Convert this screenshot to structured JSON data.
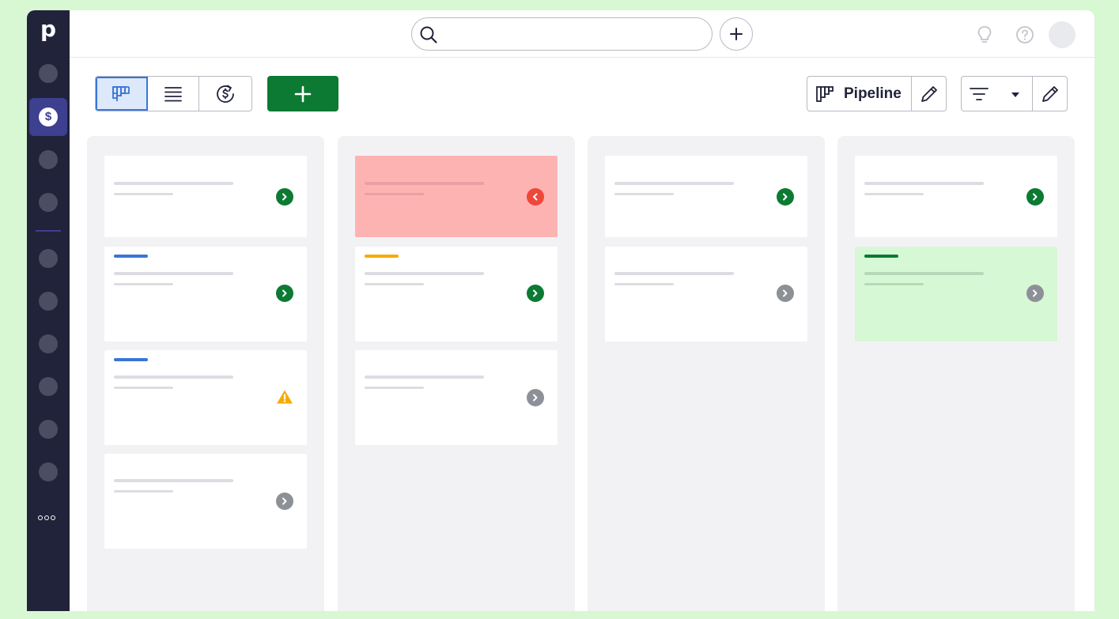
{
  "app": {
    "logo_letter": "p"
  },
  "sidebar": {
    "items": [
      "nav-item-1",
      "deals",
      "nav-item-3",
      "nav-item-4",
      "nav-item-5",
      "nav-item-6",
      "nav-item-7",
      "nav-item-8",
      "nav-item-9",
      "nav-item-10"
    ],
    "active_icon_text": "$"
  },
  "topbar": {
    "search_placeholder": ""
  },
  "toolbar": {
    "views": [
      "pipeline-view-icon",
      "list-view-icon",
      "forecast-view-icon"
    ],
    "active_view": "pipeline-view-icon",
    "new_button_icon": "plus-icon",
    "pipeline_label": "Pipeline"
  },
  "colors": {
    "accent_green": "#0c7a33",
    "accent_blue": "#3a75d8",
    "warning_orange": "#f7ab00",
    "danger_red": "#ef473a",
    "sidebar": "#21233a"
  },
  "board": {
    "columns": [
      {
        "cards": [
          {
            "status": "go",
            "tag": null,
            "bg": "white"
          },
          {
            "status": "go",
            "tag": "#3a75d8",
            "bg": "white"
          },
          {
            "status": "warning",
            "tag": "#3a75d8",
            "bg": "white"
          },
          {
            "status": "none",
            "tag": null,
            "bg": "white"
          }
        ]
      },
      {
        "cards": [
          {
            "status": "overdue",
            "tag": null,
            "bg": "red"
          },
          {
            "status": "go",
            "tag": "#f7ab00",
            "bg": "white"
          },
          {
            "status": "none",
            "tag": null,
            "bg": "white"
          }
        ]
      },
      {
        "cards": [
          {
            "status": "go",
            "tag": null,
            "bg": "white"
          },
          {
            "status": "none",
            "tag": null,
            "bg": "white"
          }
        ]
      },
      {
        "cards": [
          {
            "status": "go",
            "tag": null,
            "bg": "white"
          },
          {
            "status": "none",
            "tag": "#0c7a33",
            "bg": "green"
          }
        ]
      }
    ]
  }
}
